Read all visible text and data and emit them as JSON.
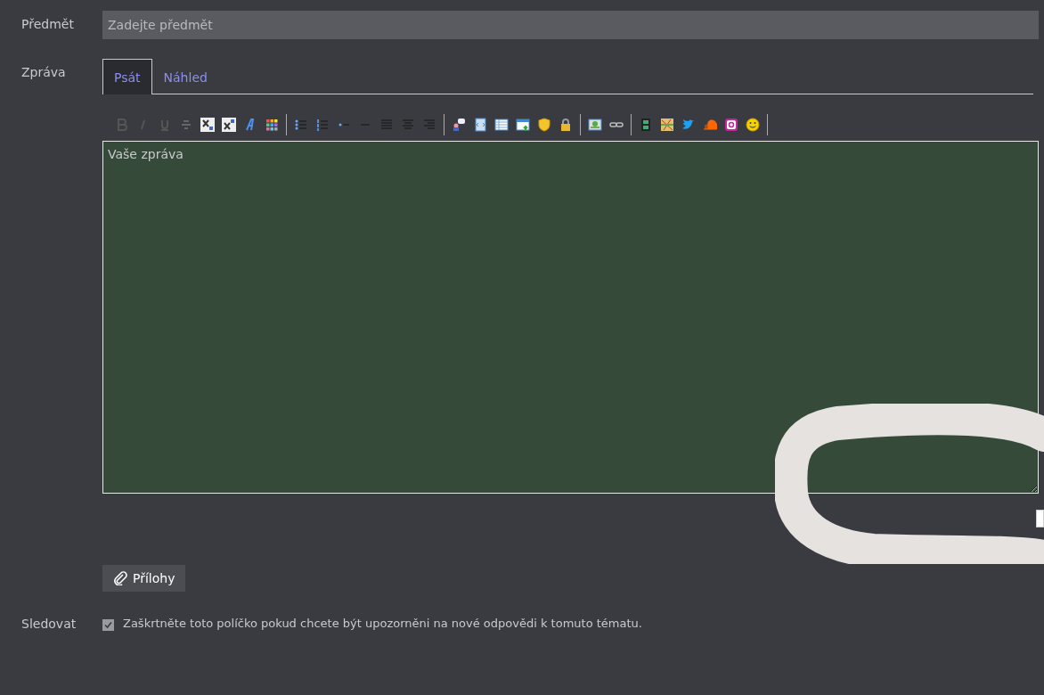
{
  "subject": {
    "label": "Předmět",
    "placeholder": "Zadejte předmět"
  },
  "message": {
    "label": "Zpráva",
    "placeholder": "Vaše zpráva"
  },
  "tabs": [
    {
      "label": "Psát",
      "selected": true
    },
    {
      "label": "Náhled",
      "selected": false
    }
  ],
  "attachments_button": "Přílohy",
  "watch": {
    "label": "Sledovat",
    "text": "Zaškrtněte toto políčko pokud chcete být upozorněni na nové odpovědi k tomuto tématu.",
    "checked": true
  }
}
